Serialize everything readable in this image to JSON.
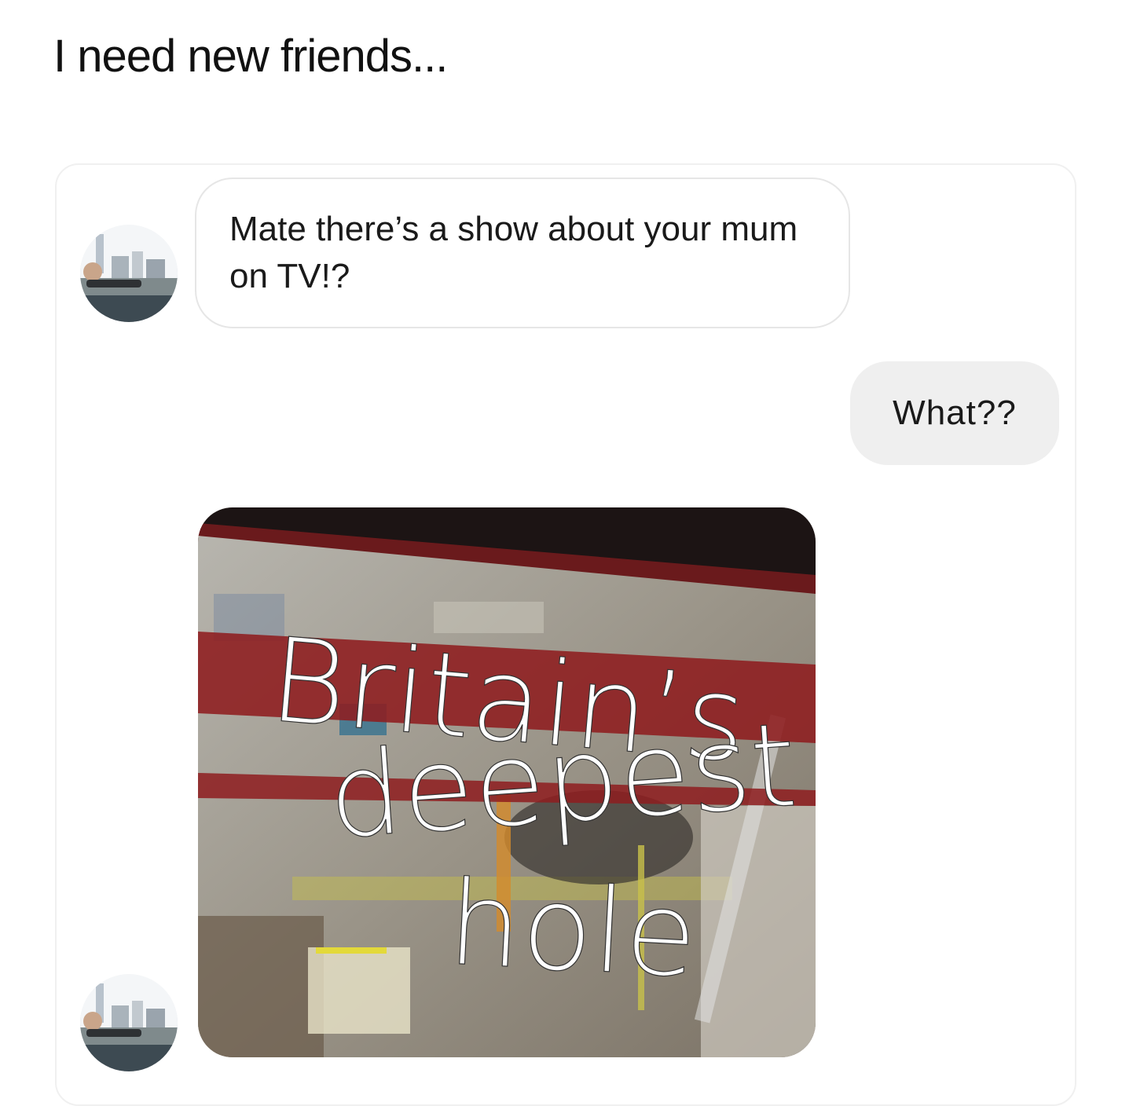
{
  "post": {
    "title": "I need new friends..."
  },
  "conversation": {
    "messages": [
      {
        "sender": "friend",
        "text": "Mate there’s a show about your mum on TV!?"
      },
      {
        "sender": "me",
        "text": "What??"
      },
      {
        "sender": "friend",
        "type": "image"
      }
    ],
    "image_caption": {
      "line1": "Britain’s",
      "line2": "deepest",
      "line3": "hole"
    }
  },
  "colors": {
    "incoming_bubble_border": "#e6e6e6",
    "outgoing_bubble": "#efefef",
    "tv_red_band": "#8e1c1f"
  },
  "icons": [
    "avatar-photo"
  ]
}
